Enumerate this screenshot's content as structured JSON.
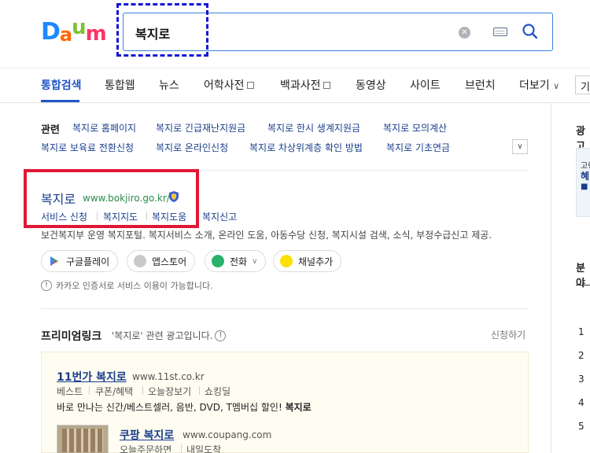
{
  "logo": {
    "letters": [
      "D",
      "a",
      "u",
      "m"
    ],
    "colors": [
      "#1e88ff",
      "#ff6600",
      "#7fc230",
      "#ff3366"
    ]
  },
  "search": {
    "query": "복지로"
  },
  "nav": {
    "items": [
      "통합검색",
      "통합웹",
      "뉴스",
      "어학사전",
      "백과사전",
      "동영상",
      "사이트",
      "브런치",
      "더보기"
    ],
    "active": "통합검색",
    "more_box": "기"
  },
  "related": {
    "label": "관련",
    "row1": [
      "복지로 홈페이지",
      "복지로 긴급재난지원금",
      "복지로 한시 생계지원금",
      "복지로 모의계산"
    ],
    "row2": [
      "복지로 보육료 전환신청",
      "복지로 온라인신청",
      "복지로 차상위계층 확인 방법",
      "복지로 기초연금"
    ]
  },
  "site": {
    "title": "복지로",
    "url": "www.bokjiro.go.kr/",
    "sublinks": [
      "서비스 신청",
      "복지지도",
      "복지도움",
      "복지신고"
    ],
    "description": "보건복지부 운영 복지포털. 복지서비스 소개, 온라인 도움, 아동수당 신청, 복지시설 검색, 소식, 부정수급신고 제공.",
    "apps": [
      "구글플레이",
      "앱스토어",
      "전화",
      "채널추가"
    ],
    "kakao_note": "카카오 인증서로 서비스 이용이 가능합니다."
  },
  "premium": {
    "title": "프리미엄링크",
    "note": "'복지로' 관련 광고입니다.",
    "apply": "신청하기",
    "ad1": {
      "title": "11번가 복지로",
      "url": "www.11st.co.kr",
      "sublinks": [
        "베스트",
        "쿠폰/혜택",
        "오늘장보기",
        "쇼킹딜"
      ],
      "desc_plain": "바로 만나는 신간/베스트셀러, 음반, DVD, T멤버십 할인! ",
      "desc_bold": "복지로"
    },
    "ad2": {
      "title": "쿠팡 복지로",
      "url": "www.coupang.com",
      "sublinks": [
        "오늘주문하면",
        "내일도착"
      ]
    }
  },
  "right": {
    "ad_title": "광고",
    "ad_lines": [
      "고령",
      "혜",
      "■"
    ],
    "rank_title": "분야",
    "ranks": [
      "1",
      "2",
      "3",
      "4",
      "5"
    ]
  }
}
